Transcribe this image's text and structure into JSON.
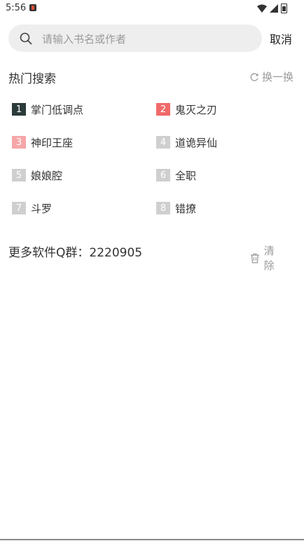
{
  "status_bar": {
    "time": "5:56"
  },
  "search": {
    "placeholder": "请输入书名或作者",
    "value": "",
    "cancel_label": "取消"
  },
  "hot_search": {
    "title": "热门搜索",
    "refresh_label": "换一换",
    "items": [
      {
        "rank": "1",
        "title": "掌门低调点"
      },
      {
        "rank": "2",
        "title": "鬼灭之刃"
      },
      {
        "rank": "3",
        "title": "神印王座"
      },
      {
        "rank": "4",
        "title": "道诡异仙"
      },
      {
        "rank": "5",
        "title": "娘娘腔"
      },
      {
        "rank": "6",
        "title": "全职"
      },
      {
        "rank": "7",
        "title": "斗罗"
      },
      {
        "rank": "8",
        "title": "错撩"
      }
    ]
  },
  "history": {
    "title": "更多软件Q群：2220905",
    "clear_label": "清除"
  },
  "colors": {
    "rank1": "#2b3a3a",
    "rank2": "#f06a6a",
    "rank3": "#f6a6a8",
    "rank_other": "#cfcfcf",
    "search_bg": "#eeeeee"
  }
}
